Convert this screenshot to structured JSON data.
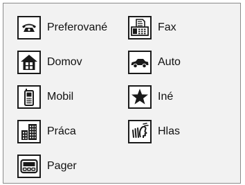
{
  "icon_color": "#1a1a1a",
  "panel_background": "#f2f2f2",
  "categories": [
    {
      "label": "Preferované",
      "icon": "telephone-icon"
    },
    {
      "label": "Fax",
      "icon": "fax-machine-icon"
    },
    {
      "label": "Domov",
      "icon": "home-icon"
    },
    {
      "label": "Auto",
      "icon": "car-icon"
    },
    {
      "label": "Mobil",
      "icon": "mobile-phone-icon"
    },
    {
      "label": "Iné",
      "icon": "star-icon"
    },
    {
      "label": "Práca",
      "icon": "office-building-icon"
    },
    {
      "label": "Hlas",
      "icon": "voice-icon"
    },
    {
      "label": "Pager",
      "icon": "pager-icon"
    }
  ]
}
